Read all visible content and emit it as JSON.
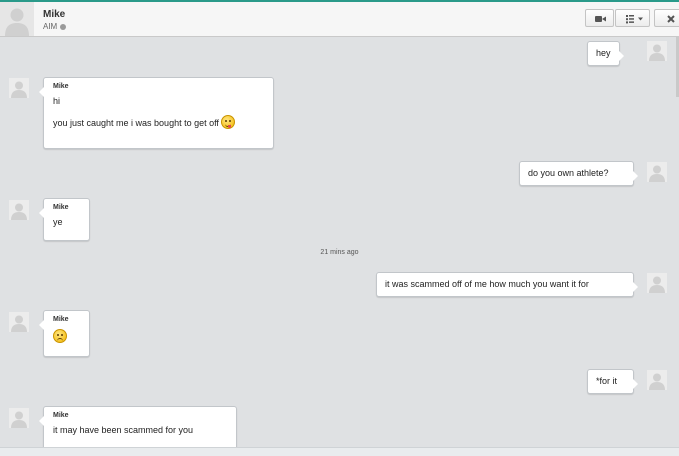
{
  "header": {
    "contact_name": "Mike",
    "service": "AIM",
    "presence_icon": "offline-dot",
    "buttons": [
      {
        "icon": "video-camera-icon"
      },
      {
        "icon": "list-menu-icon"
      },
      {
        "icon": "close-icon"
      }
    ]
  },
  "conversation": {
    "timestamp": "21 mins ago",
    "messages": [
      {
        "direction": "outgoing",
        "text": "hey"
      },
      {
        "direction": "incoming",
        "sender": "Mike",
        "line1": "hi",
        "line2": "you just caught me i was bought to get off",
        "emoji": "tongue-out-emoji"
      },
      {
        "direction": "outgoing",
        "text": "do you own athlete?"
      },
      {
        "direction": "incoming",
        "sender": "Mike",
        "line1": "ye"
      },
      {
        "direction": "outgoing",
        "text": "it was scammed off of me how much you want it for"
      },
      {
        "direction": "incoming",
        "sender": "Mike",
        "emoji": "sad-face-emoji"
      },
      {
        "direction": "outgoing",
        "text": "*for it"
      },
      {
        "direction": "incoming",
        "sender": "Mike",
        "line1": "it may have been scammed for you"
      }
    ]
  },
  "colors": {
    "accent": "#2a9a8a",
    "background": "#dfe1e3",
    "bubble": "#ffffff",
    "bubble_border": "#c2c6ca"
  }
}
